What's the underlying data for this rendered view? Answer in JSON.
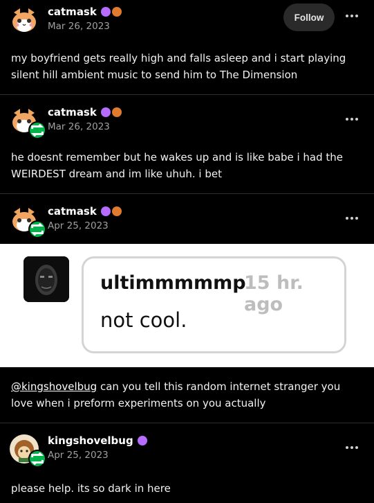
{
  "posts": [
    {
      "username": "catmask",
      "date": "Mar 26, 2023",
      "follow_label": "Follow",
      "text": "my boyfriend gets really high and falls asleep and i start playing silent hill ambient music to send him to The Dimension"
    },
    {
      "username": "catmask",
      "date": "Mar 26, 2023",
      "text": "he doesnt remember but he wakes up and is like babe i had the WEIRDEST dream and im like uhuh. i bet"
    },
    {
      "username": "catmask",
      "date": "Apr 25, 2023",
      "image": {
        "chat_user": "ultimmmmmp",
        "chat_time": "15 hr. ago",
        "chat_message": "not cool."
      },
      "mention": "@kingshovelbug",
      "text": " can you tell this random internet stranger you love when i preform experiments on you actually"
    },
    {
      "username": "kingshovelbug",
      "date": "Apr 25, 2023",
      "text": "please help. its so dark in here"
    }
  ],
  "icons": {
    "reblog": "reblog-icon",
    "more": "more-options-icon",
    "badge_purple": "purple-badge",
    "badge_paw": "paw-badge"
  },
  "colors": {
    "background": "#000000",
    "reblog_green": "#00b34a",
    "badge_purple": "#b66cff",
    "badge_orange": "#e07a2e"
  }
}
